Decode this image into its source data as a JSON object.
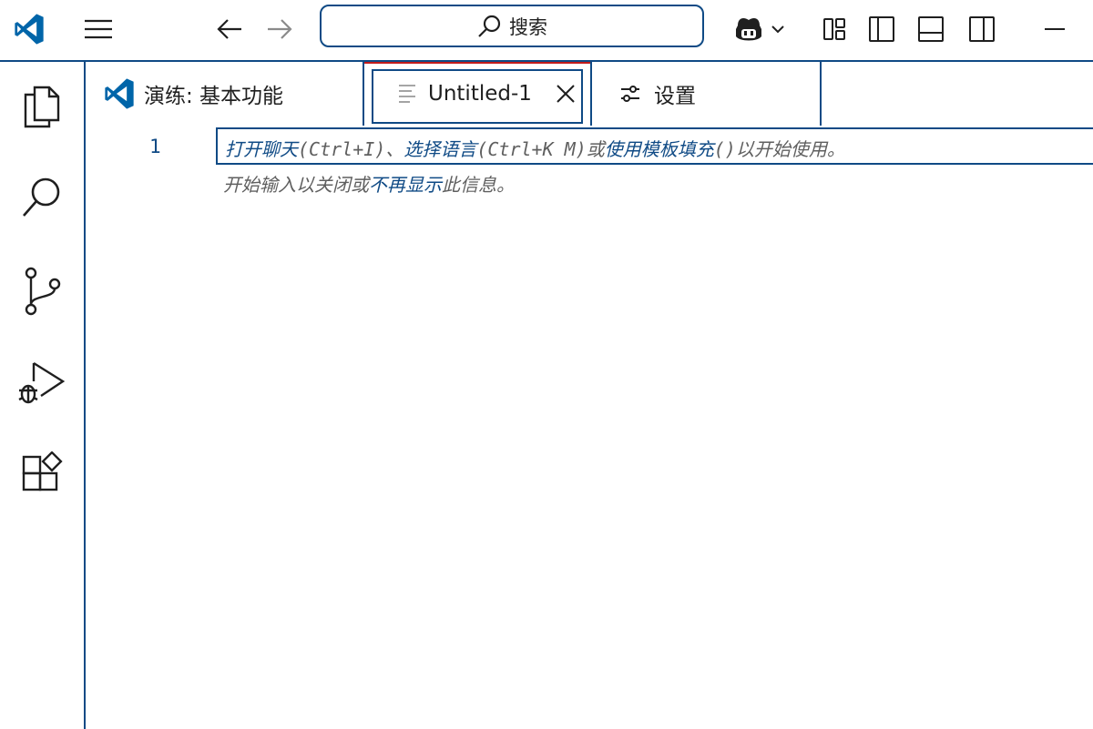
{
  "titlebar": {
    "logo_icon": "vscode-logo-icon",
    "menu_icon": "hamburger-menu-icon",
    "back_icon": "arrow-left-icon",
    "forward_icon": "arrow-right-icon",
    "search": {
      "label": "搜索",
      "icon": "search-icon"
    },
    "copilot_icon": "copilot-icon",
    "layout_icons": [
      "customize-layout-icon",
      "toggle-primary-sidebar-icon",
      "toggle-panel-icon",
      "toggle-secondary-sidebar-icon"
    ],
    "minimize_icon": "minimize-icon"
  },
  "activitybar": {
    "items": [
      {
        "icon": "files-explorer-icon"
      },
      {
        "icon": "search-icon"
      },
      {
        "icon": "source-control-icon"
      },
      {
        "icon": "run-debug-icon"
      },
      {
        "icon": "extensions-icon"
      }
    ]
  },
  "tabs": [
    {
      "label": "演练: 基本功能",
      "icon": "vscode-logo-icon",
      "active": false
    },
    {
      "label": "Untitled-1",
      "icon": "file-text-icon",
      "active": true,
      "close_icon": "close-icon"
    },
    {
      "label": "设置",
      "icon": "settings-sliders-icon",
      "active": false
    }
  ],
  "editor": {
    "line_numbers": [
      "1"
    ],
    "hint": {
      "open_chat": "打开聊天",
      "open_chat_key": "(Ctrl+I)",
      "sep": "、",
      "select_language": "选择语言",
      "select_language_key": "(Ctrl+K M)",
      "or": "或",
      "fill_template": "使用模板填充",
      "fill_template_key": "()",
      "suffix": "以开始使用。",
      "line2_prefix": "开始输入以关闭或",
      "dont_show": "不再显示",
      "line2_suffix": "此信息。"
    }
  },
  "colors": {
    "accent": "#0f4a85",
    "active_tab_top": "#c11b1b",
    "vscode_blue": "#0065a9",
    "hint_text": "#5f5f5f"
  }
}
